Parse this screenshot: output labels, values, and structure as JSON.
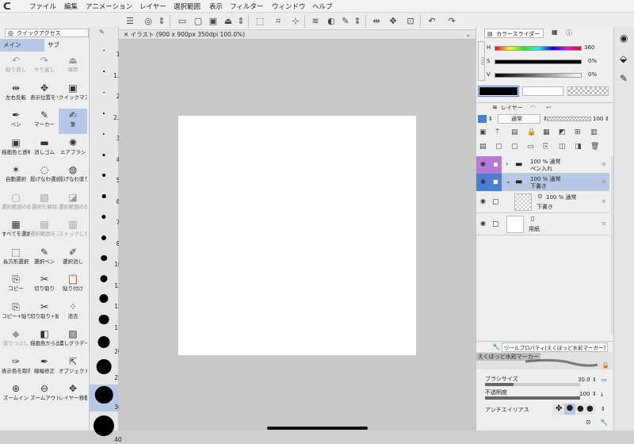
{
  "menu": {
    "items": [
      "ファイル",
      "編集",
      "アニメーション",
      "レイヤー",
      "選択範囲",
      "表示",
      "フィルター",
      "ウィンドウ",
      "ヘルプ"
    ]
  },
  "quick_access": {
    "tab": "クイックアクセス",
    "subtabs": [
      "メイン",
      "サブ"
    ],
    "buttons": [
      [
        "取り消し",
        "やり直し",
        "保存"
      ],
      [
        "左右反転",
        "表示位置をリ",
        "クイックマス"
      ],
      [
        "ペン",
        "マーカー",
        "筆"
      ],
      [
        "描画色と透明",
        "消しゴム",
        "エアブラシ"
      ],
      [
        "自動選択",
        "投げなわ選択",
        "投げなわ塗り"
      ],
      [
        "選択範囲の削",
        "選択を解除",
        "選択範囲の反"
      ],
      [
        "すべてを選択",
        "選択範囲をス",
        "ストックした"
      ],
      [
        "長方形選択",
        "選択ペン",
        "選択消し"
      ],
      [
        "コピー",
        "切り取り",
        "貼り付け"
      ],
      [
        "コピー+貼り",
        "切り取り+貼",
        "消去"
      ],
      [
        "塗りつぶし",
        "描画色から透",
        "濃しグラデー"
      ],
      [
        "表示色を取得",
        "線幅修正",
        "オブジェクト"
      ],
      [
        "ズームイン",
        "ズームアウト",
        "レイヤー移動"
      ]
    ]
  },
  "brush_sizes": [
    "1",
    "1.5",
    "2",
    "2.5",
    "3",
    "4",
    "5",
    "6",
    "7",
    "8",
    "10",
    "12",
    "15",
    "17",
    "20",
    "25",
    "30",
    "40"
  ],
  "brush_size_selected": "30",
  "document": {
    "tab_title": "イラスト (900 x 900px 350dpi 100.0%)"
  },
  "color_slider": {
    "tab": "カラースライダー",
    "channels": [
      {
        "label": "H",
        "value": "360"
      },
      {
        "label": "S",
        "value": "0%"
      },
      {
        "label": "V",
        "value": "0%"
      }
    ],
    "side_labels": [
      "HSV",
      "RGB",
      "CMY"
    ]
  },
  "colors": {
    "main": "#000000",
    "sub": "#ffffff",
    "accent_blue": "#4a7fd4",
    "selection": "#b7c8e6",
    "layer_purple": "#b57bd6"
  },
  "layers": {
    "tab": "レイヤー",
    "blend_mode": "通常",
    "opacity": "100",
    "rows": [
      {
        "line1": "100 % 通常",
        "line2": "ペン入れ"
      },
      {
        "line1": "100 % 通常",
        "line2": "下書き"
      },
      {
        "line1": "100 % 通常",
        "line2": "下書き"
      },
      {
        "line1": "",
        "line2": "用紙"
      }
    ]
  },
  "tool_property": {
    "tab": "ツールプロパティ[えくぼっど水彩マーカー]",
    "tool_name": "えくぼっど水彩マーカー",
    "brush_size_label": "ブラシサイズ",
    "brush_size_value": "30.0",
    "opacity_label": "不透明度",
    "opacity_value": "100",
    "antialias_label": "アンチエイリアス"
  }
}
